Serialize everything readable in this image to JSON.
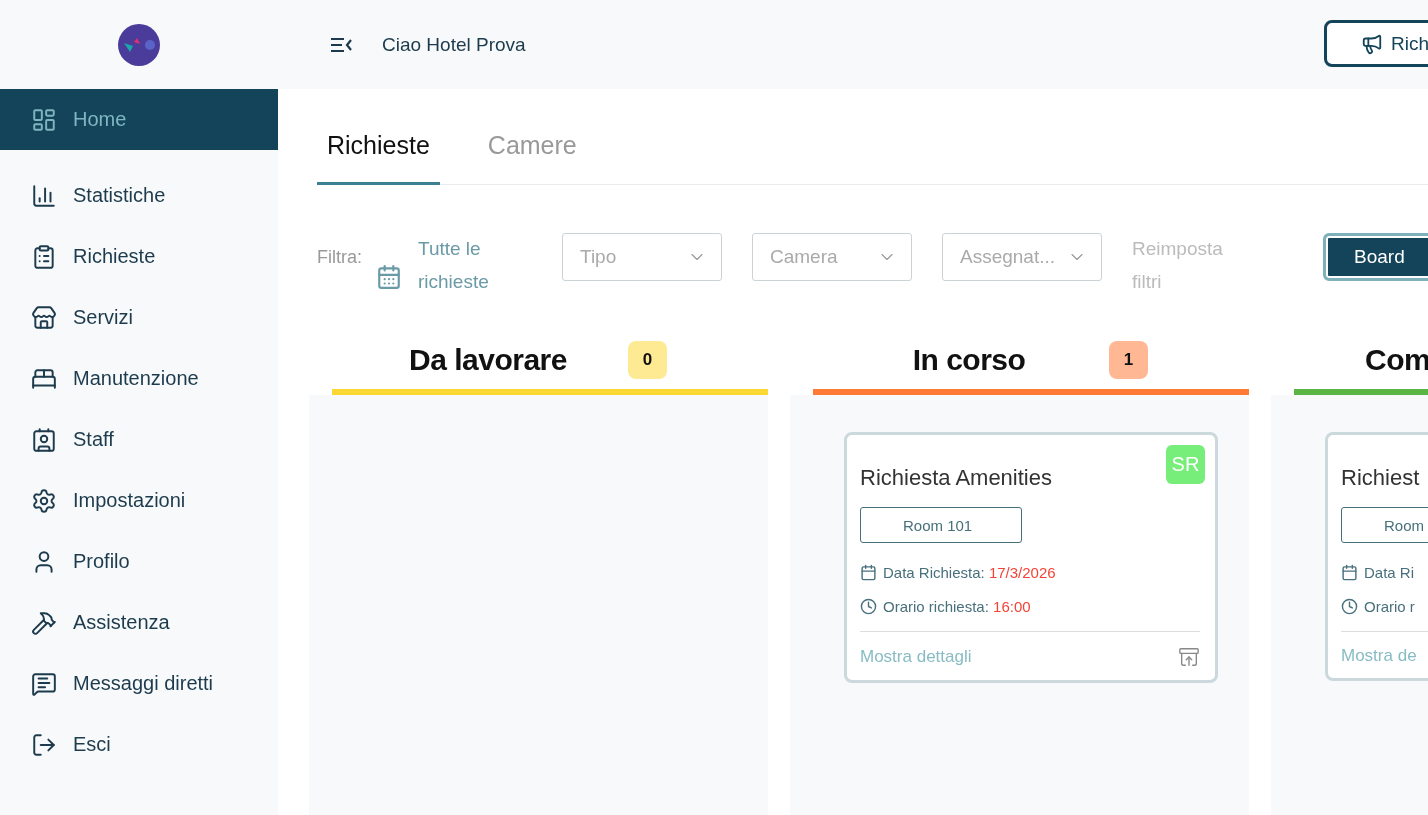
{
  "header": {
    "greeting": "Ciao Hotel Prova",
    "action_button": "Rich"
  },
  "sidebar": {
    "items": [
      {
        "label": "Home",
        "selected": true
      },
      {
        "label": "Statistiche",
        "selected": false
      },
      {
        "label": "Richieste",
        "selected": false
      },
      {
        "label": "Servizi",
        "selected": false
      },
      {
        "label": "Manutenzione",
        "selected": false
      },
      {
        "label": "Staff",
        "selected": false
      },
      {
        "label": "Impostazioni",
        "selected": false
      },
      {
        "label": "Profilo",
        "selected": false
      },
      {
        "label": "Assistenza",
        "selected": false
      },
      {
        "label": "Messaggi diretti",
        "selected": false
      },
      {
        "label": "Esci",
        "selected": false
      }
    ]
  },
  "tabs": [
    {
      "label": "Richieste",
      "selected": true
    },
    {
      "label": "Camere",
      "selected": false
    }
  ],
  "filters": {
    "label": "Filtra:",
    "date": "Tutte le richieste",
    "selects": [
      {
        "placeholder": "Tipo"
      },
      {
        "placeholder": "Camera"
      },
      {
        "placeholder": "Assegnat..."
      }
    ],
    "reset": "Reimposta filtri"
  },
  "view_buttons": [
    {
      "label": "Board",
      "selected": true
    }
  ],
  "columns": [
    {
      "title": "Da lavorare",
      "count": "0",
      "color": "#fdd835"
    },
    {
      "title": "In corso",
      "count": "1",
      "color": "#ff7a35",
      "cards": [
        {
          "title": "Richiesta Amenities",
          "initials": "SR",
          "room": "Room 101",
          "date_label": "Data Richiesta:",
          "date": "17/3/2026",
          "time_label": "Orario richiesta:",
          "time": "16:00",
          "details": "Mostra dettagli",
          "archive_button": true
        }
      ]
    },
    {
      "title": "Com",
      "color": "#5bb544",
      "cards": [
        {
          "title": "Richiest",
          "room": "Room",
          "date_label": "Data Ri",
          "time_label": "Orario r",
          "details": "Mostra de"
        }
      ]
    }
  ]
}
